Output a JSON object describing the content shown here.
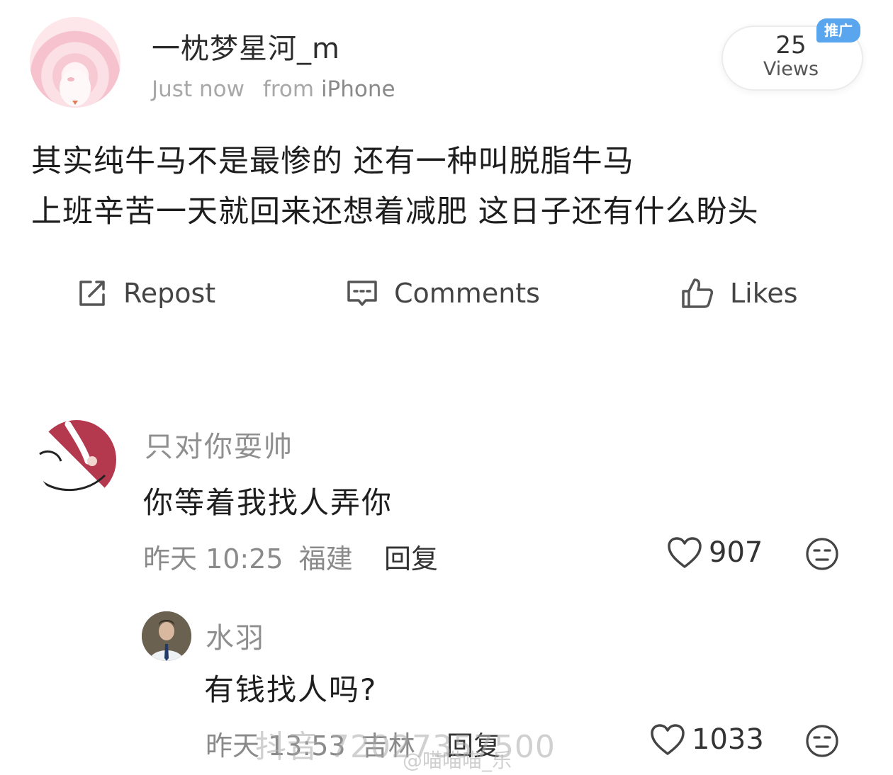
{
  "post": {
    "author": "一枕梦星河_m",
    "time": "Just now",
    "source_prefix": "from",
    "device": "iPhone",
    "views_count": "25",
    "views_label": "Views",
    "badge": "推广",
    "text_lines": [
      "其实纯牛马不是最惨的 还有一种叫脱脂牛马",
      "上班辛苦一天就回来还想着减肥 这日子还有什么盼头"
    ]
  },
  "actions": {
    "repost": "Repost",
    "comments": "Comments",
    "likes": "Likes"
  },
  "comments": [
    {
      "user": "只对你耍帅",
      "text": "你等着我找人弄你",
      "date": "昨天 10:25",
      "location": "福建",
      "reply_label": "回复",
      "likes": "907"
    }
  ],
  "replies": [
    {
      "user": "水羽",
      "text": "有钱找人吗?",
      "date": "昨天 13:53",
      "location": "吉林",
      "reply_label": "回复",
      "likes": "1033"
    }
  ],
  "watermark": {
    "main": "抖音 72027357500",
    "sub": "@喵喵喵_乐"
  },
  "colors": {
    "badge_blue": "#5aa6ee",
    "muted_gray": "#8a8a8a"
  }
}
